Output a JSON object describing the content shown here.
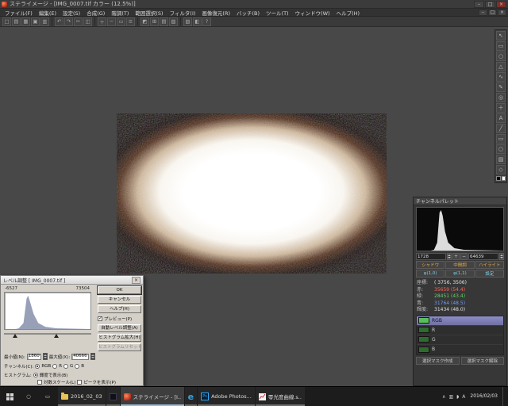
{
  "colors": {
    "sel": "#8c8cc8",
    "swatch-bright": "#58c058",
    "swatch-dim": "#2f6b2f",
    "val-red": "#ff6455",
    "val-green": "#63d663",
    "val-blue": "#6f9ff2",
    "tone": "#e3a84e",
    "phi": "#7ecfe4",
    "edge-blue": "#35a3e0",
    "ps-blue": "#31a8ff"
  },
  "window": {
    "title": "ステライメージ - [IMG_0007.tif カラー (12.5%)]",
    "minimize": "–",
    "maximize": "□",
    "close": "×"
  },
  "menubar": {
    "items": [
      "ファイル(F)",
      "編集(E)",
      "設定(S)",
      "合成(G)",
      "階調(T)",
      "範囲選択(S)",
      "フィルタ(I)",
      "画像復元(R)",
      "バッチ(B)",
      "ツール(T)",
      "ウィンドウ(W)",
      "ヘルプ(H)"
    ],
    "child": {
      "minimize": "–",
      "restore": "□",
      "close": "×"
    }
  },
  "toolbar": {
    "glyphs": [
      "□",
      "▤",
      "▦",
      "▣",
      "▥",
      "↶",
      "↷",
      "✂",
      "◫",
      "＋",
      "−",
      "▭",
      "≡",
      "◩",
      "⊞",
      "▤",
      "▧",
      "▨",
      "◧",
      "?"
    ]
  },
  "tools": {
    "glyphs": [
      "↖",
      "▭",
      "○",
      "△",
      "∿",
      "✎",
      "◎",
      "＋",
      "A",
      "╱",
      "▭",
      "○",
      "▨",
      "◇"
    ]
  },
  "channel_palette": {
    "title": "チャンネルパレット",
    "range_min": "1728",
    "range_max": "64639",
    "plus": "+",
    "minus": "−",
    "tone_buttons": [
      "シャドウ",
      "中間調",
      "ハイライト"
    ],
    "phi_buttons": [
      "φ(1,0)",
      "φ(1,1)",
      "設定"
    ],
    "info": [
      {
        "label": "座標:",
        "value": "( 3756, 3506)"
      },
      {
        "label": "赤:",
        "value": "35659 (54.4)"
      },
      {
        "label": "緑:",
        "value": "28451 (43.4)"
      },
      {
        "label": "青:",
        "value": "31764 (48.5)"
      },
      {
        "label": "輝度:",
        "value": "31434 (48.0)"
      }
    ],
    "channels": [
      {
        "label": "RGB"
      },
      {
        "label": "R"
      },
      {
        "label": "G"
      },
      {
        "label": "B"
      }
    ],
    "mask_create": "選択マスク作成",
    "mask_clear": "選択マスク解除"
  },
  "level_dialog": {
    "title": "レベル調整 [ IMG_0007.tif ]",
    "close": "×",
    "hist_left": "-6527",
    "hist_right": "73504",
    "ok": "OK",
    "cancel": "キャンセル",
    "help": "ヘルプ(H)",
    "preview": "プレビュー(P)",
    "auto": "自動レベル調整(A)",
    "expand": "ヒストグラム拡大(H)",
    "reset": "ヒストグラムリセット",
    "min_label": "最小値(N):",
    "min_value": "1860",
    "max_label": "最大値(X):",
    "max_value": "40666",
    "channel_label": "チャンネル(C):",
    "channels": [
      "RGB",
      "R",
      "G",
      "B"
    ],
    "hist_label": "ヒストグラム:",
    "opt_luminance": "輝度で表示(B)",
    "opt_log": "対数スケール(L)",
    "opt_peak": "ピークを表示(P)"
  },
  "taskbar": {
    "explorer_label": "2016_02_03",
    "stella_label": "ステライメージ - [I...",
    "edge_label": "e",
    "ps_label": "Ps",
    "photoshop_label": "Adobe Photos...",
    "chart_label": "零光度曲線.s..",
    "tray_expand": "∧",
    "tray_ime": "A",
    "tray_date": "2016/02/03"
  }
}
